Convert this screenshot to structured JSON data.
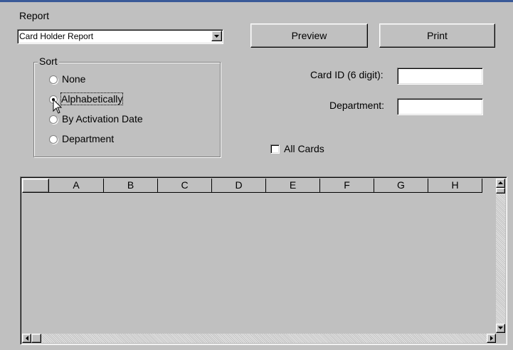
{
  "report": {
    "label": "Report",
    "selected": "Card Holder Report"
  },
  "buttons": {
    "preview": "Preview",
    "print": "Print"
  },
  "sort": {
    "title": "Sort",
    "options": [
      "None",
      "Alphabetically",
      "By Activation Date",
      "Department"
    ],
    "selected_index": 1
  },
  "filters": {
    "card_id_label": "Card ID (6 digit):",
    "card_id_value": "",
    "department_label": "Department:",
    "department_value": "",
    "all_cards_label": "All Cards",
    "all_cards_checked": false
  },
  "grid": {
    "columns": [
      "",
      "A",
      "B",
      "C",
      "D",
      "E",
      "F",
      "G",
      "H"
    ]
  },
  "icons": {
    "combo_arrow": "chevron-down-icon",
    "cursor": "mouse-pointer-icon"
  }
}
